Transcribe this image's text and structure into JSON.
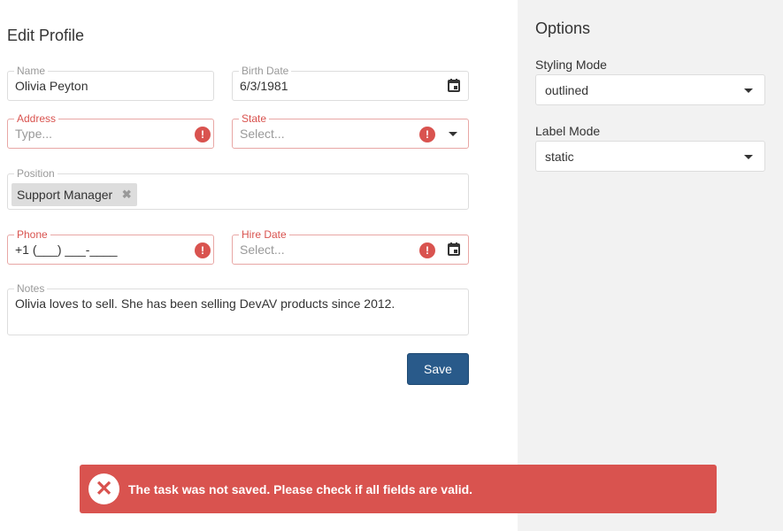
{
  "form": {
    "title": "Edit Profile",
    "name": {
      "label": "Name",
      "value": "Olivia Peyton"
    },
    "birth_date": {
      "label": "Birth Date",
      "value": "6/3/1981"
    },
    "address": {
      "label": "Address",
      "placeholder": "Type..."
    },
    "state": {
      "label": "State",
      "placeholder": "Select..."
    },
    "position": {
      "label": "Position",
      "tags": [
        "Support Manager"
      ]
    },
    "phone": {
      "label": "Phone",
      "value": "+1 (___) ___-____"
    },
    "hire_date": {
      "label": "Hire Date",
      "placeholder": "Select..."
    },
    "notes": {
      "label": "Notes",
      "value": "Olivia loves to sell. She has been selling DevAV products since 2012."
    },
    "save_label": "Save",
    "error_mark": "!"
  },
  "toast": {
    "message": "The task was not saved. Please check if all fields are valid.",
    "icon": "close-icon",
    "color": "#d9534f"
  },
  "options": {
    "title": "Options",
    "styling_mode": {
      "label": "Styling Mode",
      "value": "outlined"
    },
    "label_mode": {
      "label": "Label Mode",
      "value": "static"
    }
  },
  "colors": {
    "accent": "#295a8a",
    "error": "#d9534f",
    "sidebar_bg": "#f2f2f2"
  }
}
